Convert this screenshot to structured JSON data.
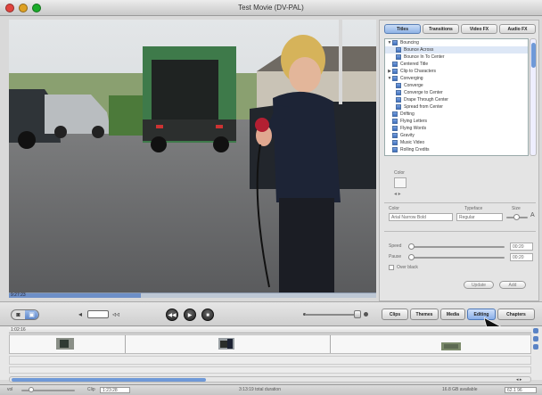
{
  "window": {
    "title": "Test Movie (DV-PAL)"
  },
  "colors": {
    "accent": "#6d8fc7",
    "selected_tab": "#89aee8"
  },
  "scrubber": {
    "time": "9:27:23",
    "progress": 0.36
  },
  "panel": {
    "tabs": [
      {
        "label": "Titles",
        "active": true
      },
      {
        "label": "Transitions",
        "active": false
      },
      {
        "label": "Video FX",
        "active": false
      },
      {
        "label": "Audio FX",
        "active": false
      }
    ],
    "titles_list": [
      {
        "label": "Bouncing",
        "level": 0,
        "expanded": true
      },
      {
        "label": "Bounce Across",
        "level": 1
      },
      {
        "label": "Bounce In To Center",
        "level": 1
      },
      {
        "label": "Centered Title",
        "level": 0
      },
      {
        "label": "Clip to Characters",
        "level": 0,
        "expanded": false
      },
      {
        "label": "Converging",
        "level": 0,
        "expanded": true
      },
      {
        "label": "Converge",
        "level": 1
      },
      {
        "label": "Converge to Center",
        "level": 1
      },
      {
        "label": "Drape Through Center",
        "level": 1
      },
      {
        "label": "Spread from Center",
        "level": 1
      },
      {
        "label": "Drifting",
        "level": 0
      },
      {
        "label": "Flying Letters",
        "level": 0
      },
      {
        "label": "Flying Words",
        "level": 0
      },
      {
        "label": "Gravity",
        "level": 0
      },
      {
        "label": "Music Video",
        "level": 0
      },
      {
        "label": "Rolling Credits",
        "level": 0
      }
    ],
    "labels": {
      "color": "Color",
      "typeface": "Typeface",
      "size": "Size",
      "speed": "Speed",
      "pause": "Pause",
      "over_black": "Over black",
      "update": "Update",
      "add": "Add"
    },
    "fields": {
      "color_value": "Arial Narrow Bold",
      "typeface_value": "Regular",
      "speed_value": "00:20",
      "pause_value": "00:20",
      "size_icon": "A"
    }
  },
  "controls": {
    "mode": [
      "cam",
      "clip"
    ],
    "rewind_icon": "rewind-icon",
    "play_icon": "play-icon",
    "fullscreen_icon": "fullscreen-icon",
    "pane_tabs": [
      {
        "label": "Clips",
        "active": false
      },
      {
        "label": "Themes",
        "active": false
      },
      {
        "label": "Media",
        "active": false
      },
      {
        "label": "Editing",
        "active": true
      },
      {
        "label": "Chapters",
        "active": false
      }
    ]
  },
  "timeline": {
    "ruler_label": "1:02:16"
  },
  "status": {
    "volume_label": "vol",
    "scale_label": "Clip",
    "time_field": "1:23:28",
    "info": "3:13:19 total duration",
    "free_space": "16.8 GB available",
    "counter": "62.1 96"
  }
}
